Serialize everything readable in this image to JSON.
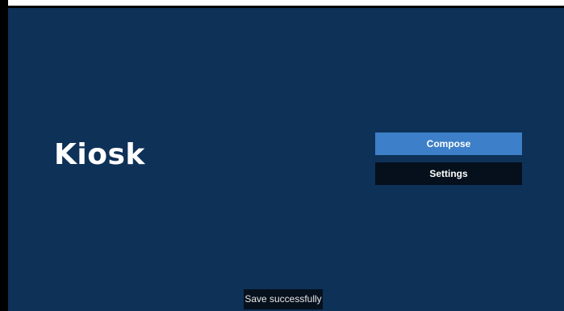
{
  "app": {
    "title": "Kiosk"
  },
  "menu": {
    "compose_label": "Compose",
    "settings_label": "Settings"
  },
  "toast": {
    "message": "Save successfully"
  },
  "colors": {
    "background": "#0e3158",
    "selected_button": "#3d7fc8",
    "unselected_button": "#05101c",
    "text": "#ffffff"
  }
}
